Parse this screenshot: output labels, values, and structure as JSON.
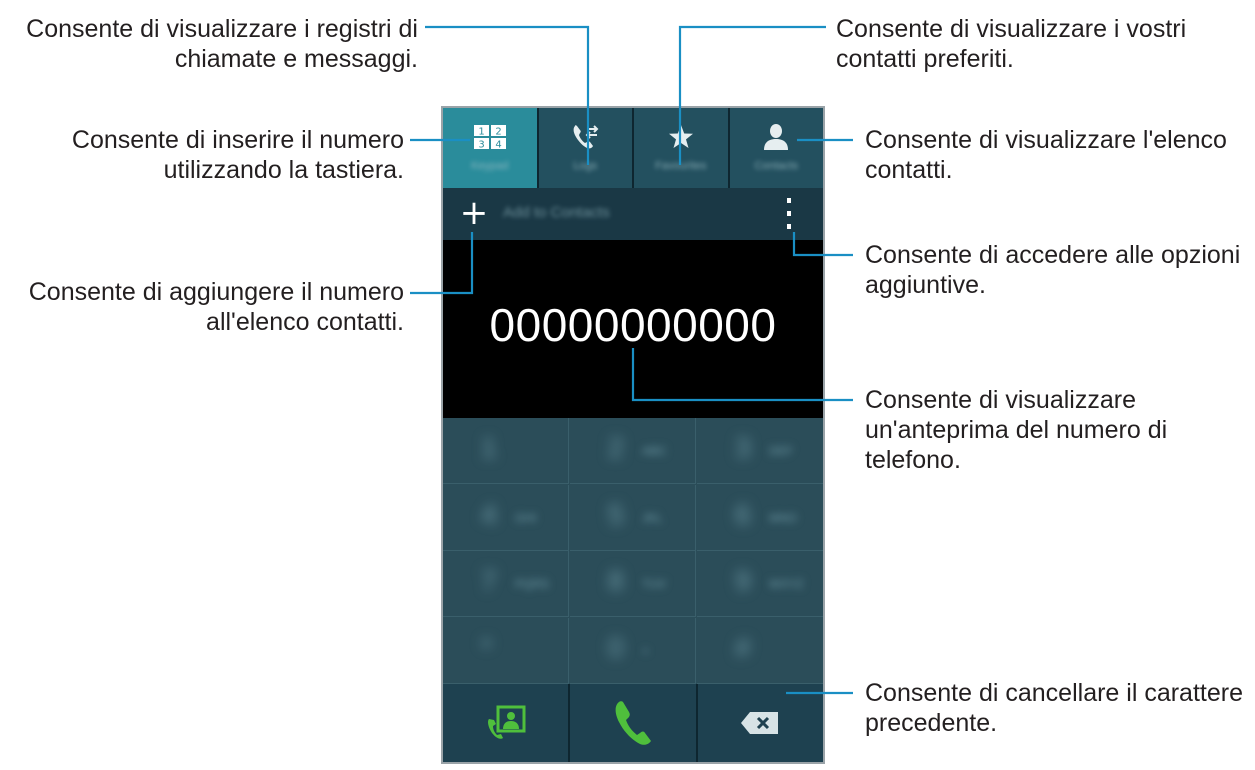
{
  "callouts": {
    "logs": "Consente di visualizzare i registri di\nchiamate e messaggi.",
    "favorites": "Consente di visualizzare i vostri\ncontatti preferiti.",
    "keypad": "Consente di inserire il numero\nutilizzando la tastiera.",
    "contacts": "Consente di visualizzare l'elenco\ncontatti.",
    "add": "Consente di aggiungere il numero\nall'elenco contatti.",
    "more": "Consente di accedere alle opzioni\naggiuntive.",
    "preview": "Consente di visualizzare\nun'anteprima del numero di\ntelefono.",
    "delete": "Consente di cancellare il carattere\nprecedente."
  },
  "phone": {
    "tabs": [
      {
        "label": "Keypad",
        "icon": "keypad-icon"
      },
      {
        "label": "Logs",
        "icon": "call-log-icon"
      },
      {
        "label": "Favourites",
        "icon": "star-icon"
      },
      {
        "label": "Contacts",
        "icon": "person-icon"
      }
    ],
    "add_to_contacts": "Add to Contacts",
    "number": "00000000000",
    "keypad_icon_digits": [
      "1",
      "2",
      "3",
      "4"
    ],
    "keys": [
      {
        "digit": "1",
        "letters": ""
      },
      {
        "digit": "2",
        "letters": "ABC"
      },
      {
        "digit": "3",
        "letters": "DEF"
      },
      {
        "digit": "4",
        "letters": "GHI"
      },
      {
        "digit": "5",
        "letters": "JKL"
      },
      {
        "digit": "6",
        "letters": "MNO"
      },
      {
        "digit": "7",
        "letters": "PQRS"
      },
      {
        "digit": "8",
        "letters": "TUV"
      },
      {
        "digit": "9",
        "letters": "WXYZ"
      },
      {
        "digit": "*",
        "letters": ""
      },
      {
        "digit": "0",
        "letters": "+"
      },
      {
        "digit": "#",
        "letters": ""
      }
    ]
  },
  "colors": {
    "line": "#1a8fc4",
    "active_tab": "#2a8c9b",
    "call_green": "#4fbf3c"
  }
}
